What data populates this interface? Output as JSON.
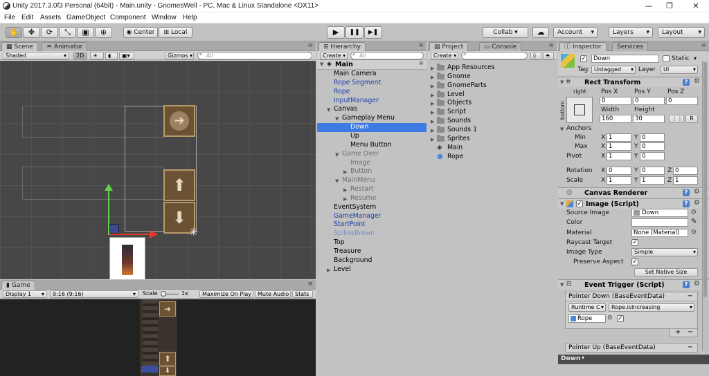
{
  "window": {
    "title": "Unity 2017.3.0f3 Personal (64bit) - Main.unity - GnomesWell - PC, Mac & Linux Standalone <DX11>",
    "minimize": "—",
    "maximize": "❐",
    "close": "✕"
  },
  "menu": [
    "File",
    "Edit",
    "Assets",
    "GameObject",
    "Component",
    "Window",
    "Help"
  ],
  "toolbar": {
    "tools": [
      "✋",
      "✥",
      "⟳",
      "⤡",
      "▣",
      "⊕"
    ],
    "pivot": "Center",
    "space": "Local",
    "play": "▶",
    "pause": "❚❚",
    "step": "▶❚",
    "collab": "Collab ▾",
    "cloud": "☁",
    "account": "Account",
    "layers": "Layers",
    "layout": "Layout"
  },
  "scene": {
    "tab_scene": "Scene",
    "tab_animator": "Animator",
    "shading": "Shaded",
    "mode2d": "2D",
    "gizmos": "Gizmos",
    "search_placeholder": "All"
  },
  "game": {
    "tab": "Game",
    "display": "Display 1",
    "aspect": "9:16 (9:16)",
    "scale_label": "Scale",
    "scale_value": "1x",
    "maximize_on_play": "Maximize On Play",
    "mute_audio": "Mute Audio",
    "stats": "Stats"
  },
  "hierarchy": {
    "tab": "Hierarchy",
    "create": "Create",
    "search_placeholder": "All",
    "scene_name": "Main",
    "items": [
      {
        "label": "Main Camera",
        "indent": 1,
        "style": "normal"
      },
      {
        "label": "Rope Segment",
        "indent": 1,
        "style": "blue"
      },
      {
        "label": "Rope",
        "indent": 1,
        "style": "blue"
      },
      {
        "label": "InputManager",
        "indent": 1,
        "style": "blue"
      },
      {
        "label": "Canvas",
        "indent": 1,
        "style": "normal",
        "arrow": "open"
      },
      {
        "label": "Gameplay Menu",
        "indent": 2,
        "style": "normal",
        "arrow": "open"
      },
      {
        "label": "Down",
        "indent": 3,
        "style": "selected"
      },
      {
        "label": "Up",
        "indent": 3,
        "style": "normal"
      },
      {
        "label": "Menu Button",
        "indent": 3,
        "style": "normal"
      },
      {
        "label": "Game Over",
        "indent": 2,
        "style": "dim",
        "arrow": "open"
      },
      {
        "label": "Image",
        "indent": 3,
        "style": "dim"
      },
      {
        "label": "Button",
        "indent": 3,
        "style": "dim",
        "arrow": "closed"
      },
      {
        "label": "MainMenu",
        "indent": 2,
        "style": "dim",
        "arrow": "open"
      },
      {
        "label": "Restart",
        "indent": 3,
        "style": "dim",
        "arrow": "closed"
      },
      {
        "label": "Resume",
        "indent": 3,
        "style": "dim",
        "arrow": "closed"
      },
      {
        "label": "EventSystem",
        "indent": 1,
        "style": "normal"
      },
      {
        "label": "GameManager",
        "indent": 1,
        "style": "blue"
      },
      {
        "label": "StartPoint",
        "indent": 1,
        "style": "blue"
      },
      {
        "label": "SpikesBrown",
        "indent": 1,
        "style": "dimblue"
      },
      {
        "label": "Top",
        "indent": 1,
        "style": "normal"
      },
      {
        "label": "Treasure",
        "indent": 1,
        "style": "normal"
      },
      {
        "label": "Background",
        "indent": 1,
        "style": "normal"
      },
      {
        "label": "Level",
        "indent": 1,
        "style": "normal",
        "arrow": "closed"
      }
    ]
  },
  "project": {
    "tab_project": "Project",
    "tab_console": "Console",
    "create": "Create",
    "items": [
      {
        "label": "App Resources",
        "kind": "folder"
      },
      {
        "label": "Gnome",
        "kind": "folder"
      },
      {
        "label": "GnomeParts",
        "kind": "folder"
      },
      {
        "label": "Level",
        "kind": "folder"
      },
      {
        "label": "Objects",
        "kind": "folder"
      },
      {
        "label": "Script",
        "kind": "folder"
      },
      {
        "label": "Sounds",
        "kind": "folder"
      },
      {
        "label": "Sounds 1",
        "kind": "folder"
      },
      {
        "label": "Sprites",
        "kind": "folder"
      },
      {
        "label": "Main",
        "kind": "scene"
      },
      {
        "label": "Rope",
        "kind": "prefab"
      }
    ]
  },
  "inspector": {
    "tab_inspector": "Inspector",
    "tab_services": "Services",
    "object_name": "Down",
    "static_label": "Static",
    "tag_label": "Tag",
    "tag_value": "Untagged",
    "layer_label": "Layer",
    "layer_value": "UI",
    "rect_transform": {
      "title": "Rect Transform",
      "anchor_h": "right",
      "anchor_v": "bottom",
      "pos_x_label": "Pos X",
      "pos_x": "0",
      "pos_y_label": "Pos Y",
      "pos_y": "0",
      "pos_z_label": "Pos Z",
      "pos_z": "0",
      "width_label": "Width",
      "width": "160",
      "height_label": "Height",
      "height": "30",
      "r_label": "R",
      "anchors_label": "Anchors",
      "min_label": "Min",
      "min_x": "1",
      "min_y": "0",
      "max_label": "Max",
      "max_x": "1",
      "max_y": "0",
      "pivot_label": "Pivot",
      "pivot_x": "1",
      "pivot_y": "0",
      "rotation_label": "Rotation",
      "rot_x": "0",
      "rot_y": "0",
      "rot_z": "0",
      "scale_label": "Scale",
      "scale_x": "1",
      "scale_y": "1",
      "scale_z": "1",
      "x": "X",
      "y": "Y",
      "z": "Z"
    },
    "canvas_renderer": {
      "title": "Canvas Renderer"
    },
    "image": {
      "title": "Image (Script)",
      "source_image_label": "Source Image",
      "source_image": "Down",
      "color_label": "Color",
      "material_label": "Material",
      "material": "None (Material)",
      "raycast_label": "Raycast Target",
      "image_type_label": "Image Type",
      "image_type": "Simple",
      "preserve_label": "Preserve Aspect",
      "set_native": "Set Native Size"
    },
    "event_trigger": {
      "title": "Event Trigger (Script)",
      "pointer_down": "Pointer Down (BaseEventData)",
      "runtime": "Runtime C",
      "function": "Rope.isIncreasing",
      "object": "Rope",
      "add": "+",
      "remove": "−",
      "pointer_up": "Pointer Up (BaseEventData)"
    },
    "footer_label": "Down"
  },
  "colors": {
    "selection": "#3d7ae2",
    "prefab_blue": "#1a3fa8",
    "scene_bg": "#474747",
    "help_icon": "#4b7fd1"
  }
}
